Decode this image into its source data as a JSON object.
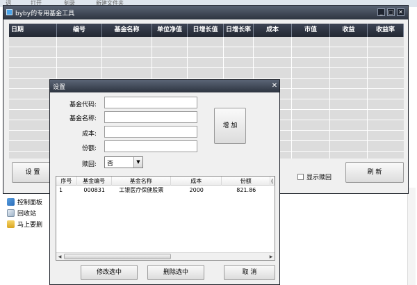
{
  "background": {
    "menu_items": [
      "词",
      "打开",
      "刻录",
      "新建文件夹"
    ],
    "desktop_items": [
      {
        "label": "控制面板",
        "icon": "control-panel-icon"
      },
      {
        "label": "回收站",
        "icon": "recycle-bin-icon"
      },
      {
        "label": "马上要删",
        "icon": "folder-icon"
      }
    ]
  },
  "main_window": {
    "title": "byby的专用基金工具",
    "columns": [
      "日期",
      "编号",
      "基金名称",
      "单位净值",
      "日增长值",
      "日增长率",
      "成本",
      "市值",
      "收益",
      "收益率"
    ],
    "settings_button": "设 置",
    "show_redeemed_label": "显示赎回",
    "refresh_button": "刷 新"
  },
  "dialog": {
    "title": "设置",
    "fields": {
      "fund_code_label": "基金代码:",
      "fund_code_value": "",
      "fund_name_label": "基金名称:",
      "fund_name_value": "",
      "cost_label": "成本:",
      "cost_value": "",
      "shares_label": "份额:",
      "shares_value": "",
      "redeem_label": "赎回:",
      "redeem_value": "否"
    },
    "add_button": "增 加",
    "list_columns": [
      "序号",
      "基金编号",
      "基金名称",
      "成本",
      "份额",
      "("
    ],
    "list_rows": [
      {
        "no": "1",
        "code": "000831",
        "name": "工银医疗保健股票",
        "cost": "2000",
        "shares": "821.86",
        "extra": ""
      }
    ],
    "modify_button": "修改选中",
    "delete_button": "删除选中",
    "cancel_button": "取 消"
  },
  "colors": {
    "titlebar": "#2d3440",
    "grid_body": "#dcdcdc",
    "window_bg": "#f0f0f0"
  }
}
